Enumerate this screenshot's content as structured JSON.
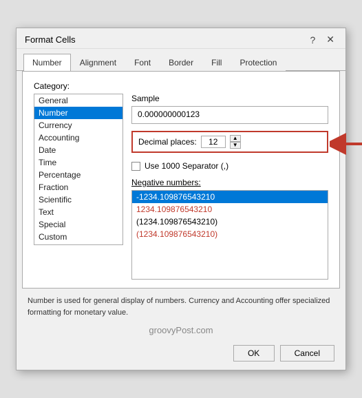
{
  "dialog": {
    "title": "Format Cells",
    "help_icon": "?",
    "close_icon": "✕"
  },
  "tabs": [
    {
      "label": "Number",
      "active": true
    },
    {
      "label": "Alignment",
      "active": false
    },
    {
      "label": "Font",
      "active": false
    },
    {
      "label": "Border",
      "active": false
    },
    {
      "label": "Fill",
      "active": false
    },
    {
      "label": "Protection",
      "active": false
    }
  ],
  "category": {
    "label": "Category:",
    "items": [
      {
        "label": "General",
        "selected": false
      },
      {
        "label": "Number",
        "selected": true
      },
      {
        "label": "Currency",
        "selected": false
      },
      {
        "label": "Accounting",
        "selected": false
      },
      {
        "label": "Date",
        "selected": false
      },
      {
        "label": "Time",
        "selected": false
      },
      {
        "label": "Percentage",
        "selected": false
      },
      {
        "label": "Fraction",
        "selected": false
      },
      {
        "label": "Scientific",
        "selected": false
      },
      {
        "label": "Text",
        "selected": false
      },
      {
        "label": "Special",
        "selected": false
      },
      {
        "label": "Custom",
        "selected": false
      }
    ]
  },
  "sample": {
    "label": "Sample",
    "value": "0.000000000123"
  },
  "decimal": {
    "label": "Decimal places:",
    "value": "12"
  },
  "separator": {
    "label": "Use 1000 Separator (,)"
  },
  "negative_numbers": {
    "label": "Negative numbers:",
    "items": [
      {
        "label": "-1234.109876543210",
        "selected": true,
        "style": "selected-blue"
      },
      {
        "label": "1234.109876543210",
        "selected": false,
        "style": "red"
      },
      {
        "label": "(1234.109876543210)",
        "selected": false,
        "style": "normal"
      },
      {
        "label": "(1234.109876543210)",
        "selected": false,
        "style": "red-paren"
      }
    ]
  },
  "footer": {
    "description": "Number is used for general display of numbers.  Currency and Accounting offer specialized formatting for monetary value."
  },
  "watermark": {
    "text": "groovyPost.com"
  },
  "buttons": {
    "ok": "OK",
    "cancel": "Cancel"
  }
}
